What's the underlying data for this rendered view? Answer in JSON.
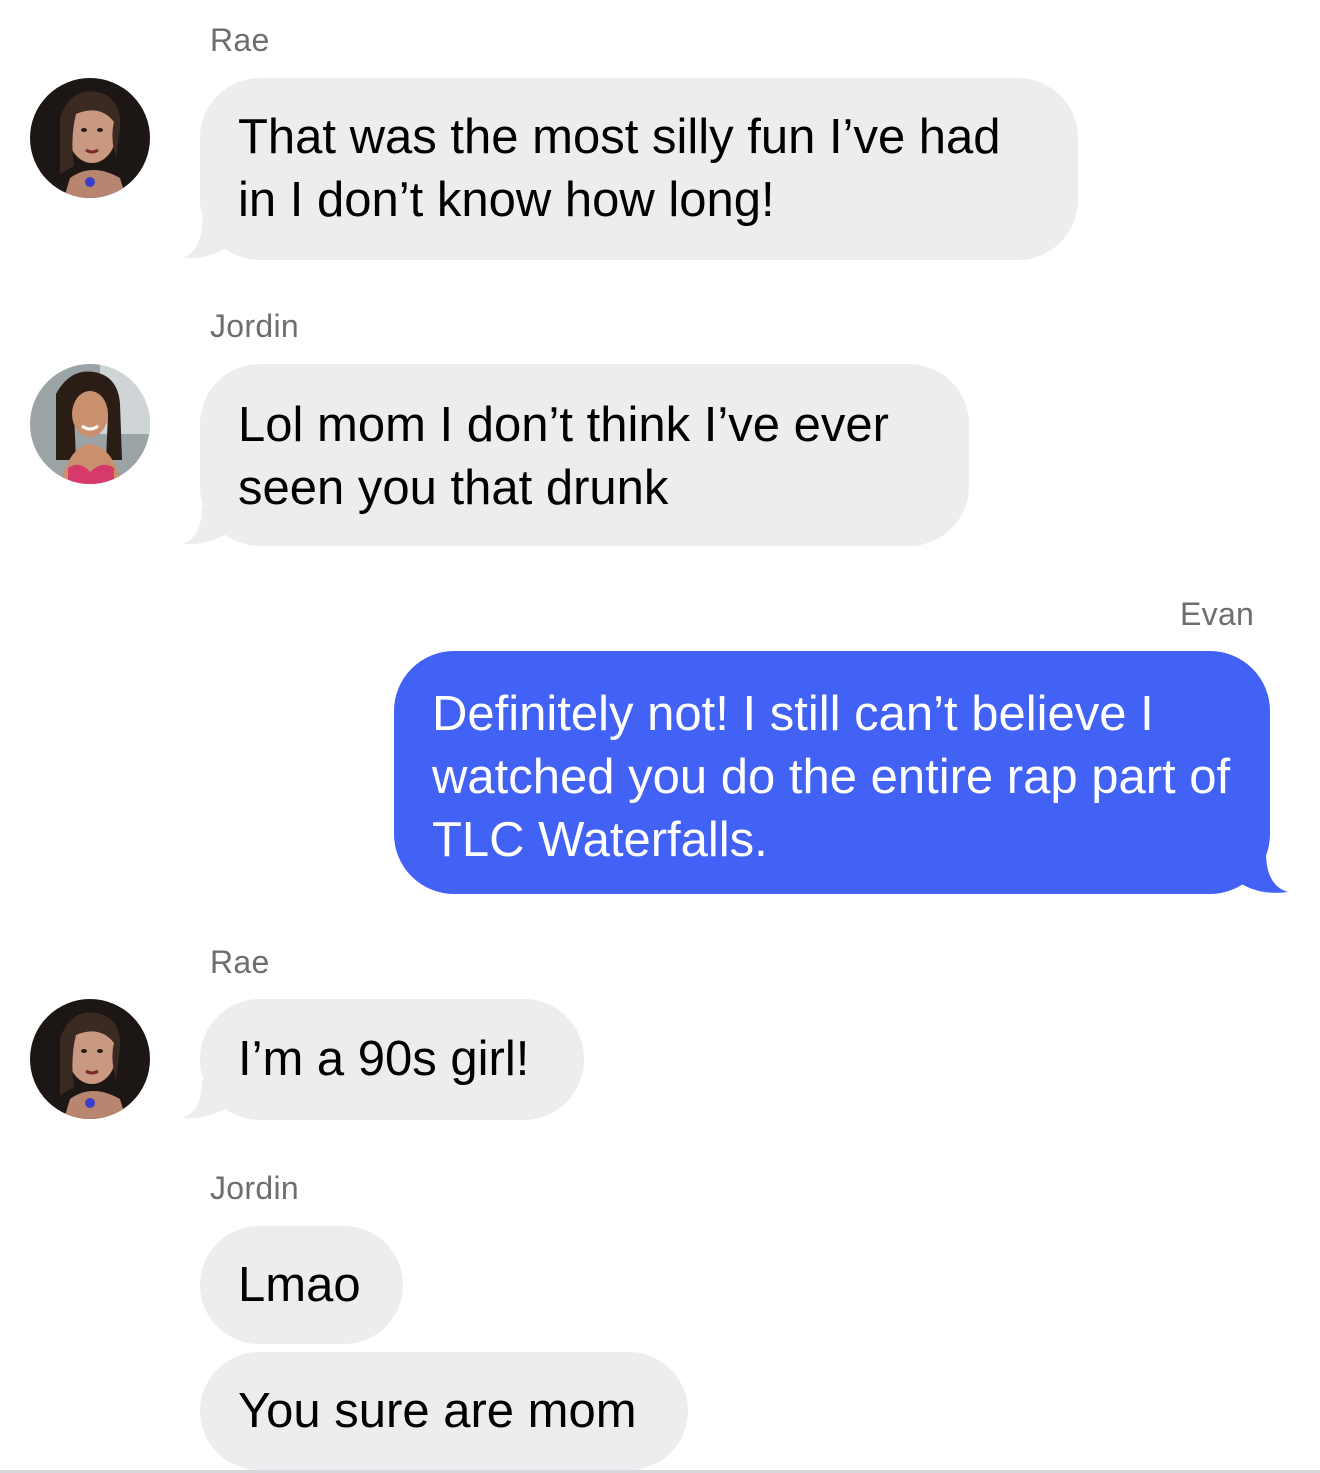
{
  "messages": [
    {
      "sender": "Rae",
      "text": "That was the most silly fun I’ve had in I don’t know how long!"
    },
    {
      "sender": "Jordin",
      "text": "Lol mom I don’t think I’ve ever seen you that drunk"
    },
    {
      "sender": "Evan",
      "text": "Definitely not! I still can’t believe I watched you do the entire rap part of TLC Waterfalls."
    },
    {
      "sender": "Rae",
      "text": "I’m a 90s girl!"
    },
    {
      "sender": "Jordin",
      "text": "Lmao"
    },
    {
      "sender": "Jordin",
      "text": "You sure are mom"
    }
  ],
  "colors": {
    "received_bubble": "#ededf0",
    "sent_bubble": "#4262f6",
    "sender_name": "#6d6d72"
  }
}
